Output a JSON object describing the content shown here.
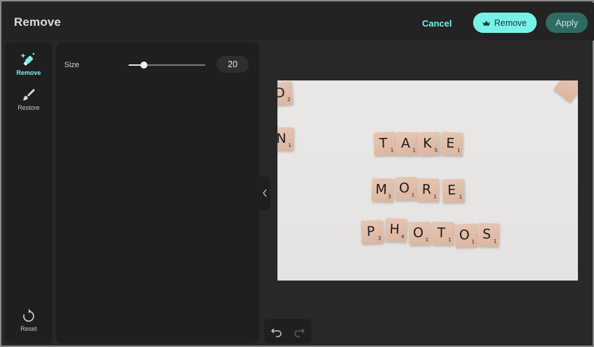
{
  "header": {
    "title": "Remove",
    "cancel_label": "Cancel",
    "remove_label": "Remove",
    "apply_label": "Apply"
  },
  "tools": {
    "remove_label": "Remove",
    "restore_label": "Restore",
    "reset_label": "Reset"
  },
  "settings": {
    "size_label": "Size",
    "size_value": "20",
    "slider_fraction": 0.2
  },
  "canvas": {
    "tiles": [
      {
        "ch": "D",
        "pt": "2"
      },
      {
        "ch": "N",
        "pt": "1"
      },
      {
        "ch": "T",
        "pt": "1"
      },
      {
        "ch": "A",
        "pt": "1"
      },
      {
        "ch": "K",
        "pt": "5"
      },
      {
        "ch": "E",
        "pt": "1"
      },
      {
        "ch": "M",
        "pt": "3"
      },
      {
        "ch": "O",
        "pt": "1"
      },
      {
        "ch": "R",
        "pt": "1"
      },
      {
        "ch": "E",
        "pt": "1"
      },
      {
        "ch": "P",
        "pt": "3"
      },
      {
        "ch": "H",
        "pt": "4"
      },
      {
        "ch": "O",
        "pt": "1"
      },
      {
        "ch": "T",
        "pt": "1"
      },
      {
        "ch": "O",
        "pt": "1"
      },
      {
        "ch": "S",
        "pt": "1"
      }
    ]
  },
  "icons": {
    "accent": "#76f3e6",
    "remove_tool": "eraser-sparkle-icon",
    "restore_tool": "brush-icon",
    "reset": "reset-icon",
    "premium": "crown-icon",
    "undo": "undo-icon",
    "redo": "redo-icon",
    "collapse": "chevron-left-icon"
  }
}
